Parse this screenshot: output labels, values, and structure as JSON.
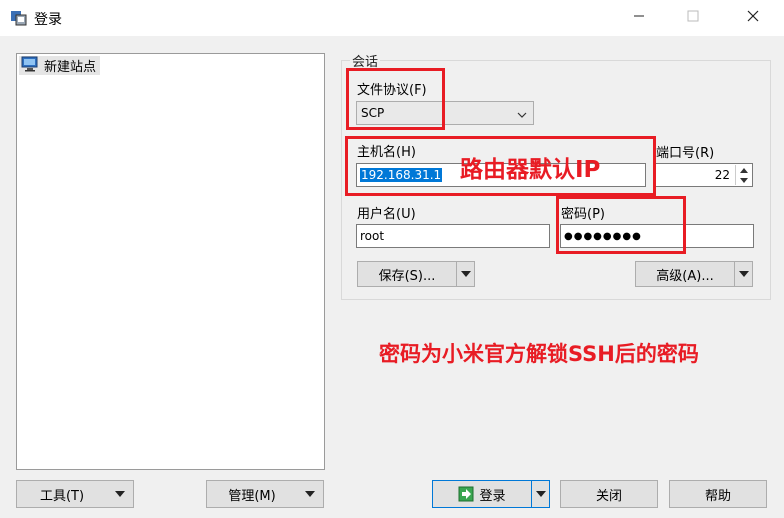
{
  "window": {
    "title": "登录"
  },
  "tree": {
    "items": [
      {
        "label": "新建站点"
      }
    ]
  },
  "session": {
    "group_label": "会话",
    "protocol_label": "文件协议(F)",
    "protocol_value": "SCP",
    "host_label": "主机名(H)",
    "host_value": "192.168.31.1",
    "port_label": "端口号(R)",
    "port_value": "22",
    "user_label": "用户名(U)",
    "user_value": "root",
    "password_label": "密码(P)",
    "password_value": "●●●●●●●●",
    "save_label": "保存(S)...",
    "advanced_label": "高级(A)..."
  },
  "annotations": {
    "router_ip": "路由器默认IP",
    "password_note": "密码为小米官方解锁SSH后的密码",
    "color": "#e81c24"
  },
  "footer": {
    "tools_label": "工具(T)",
    "manage_label": "管理(M)",
    "login_label": "登录",
    "close_label": "关闭",
    "help_label": "帮助"
  },
  "icons": [
    "app-icon",
    "minimize-icon",
    "maximize-icon",
    "close-icon",
    "computer-icon",
    "chevron-down-icon",
    "spin-up-icon",
    "spin-down-icon",
    "login-icon"
  ]
}
